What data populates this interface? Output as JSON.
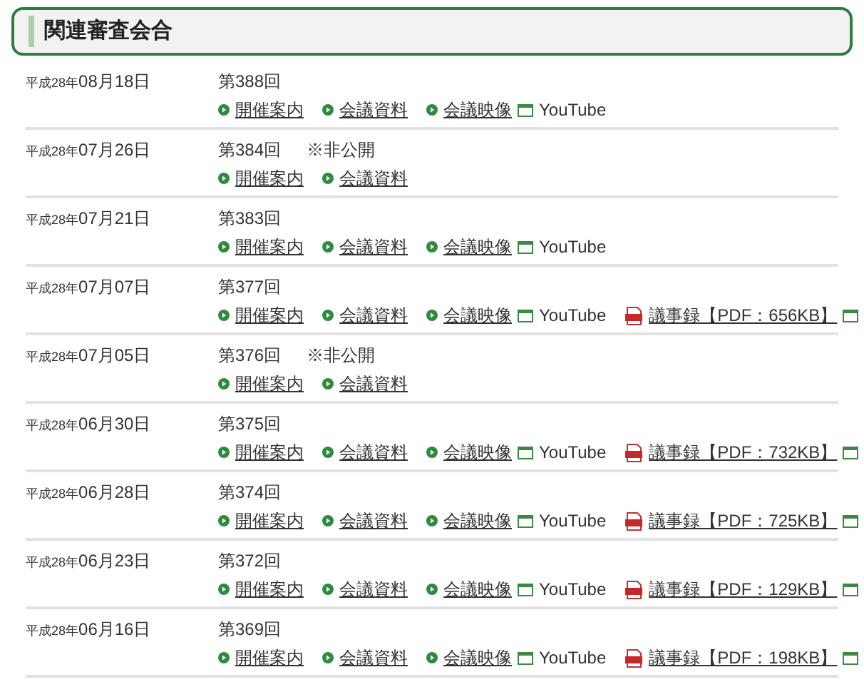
{
  "heading": "関連審査会合",
  "meetings": [
    {
      "era": "平成28年",
      "date": "08月18日",
      "session": "第388回",
      "links": [
        {
          "kind": "bullet",
          "label": "開催案内"
        },
        {
          "kind": "bullet",
          "label": "会議資料"
        },
        {
          "kind": "video",
          "label": "会議映像",
          "service": "YouTube"
        }
      ]
    },
    {
      "era": "平成28年",
      "date": "07月26日",
      "session": "第384回",
      "note": "※非公開",
      "links": [
        {
          "kind": "bullet",
          "label": "開催案内"
        },
        {
          "kind": "bullet",
          "label": "会議資料"
        }
      ]
    },
    {
      "era": "平成28年",
      "date": "07月21日",
      "session": "第383回",
      "links": [
        {
          "kind": "bullet",
          "label": "開催案内"
        },
        {
          "kind": "bullet",
          "label": "会議資料"
        },
        {
          "kind": "video",
          "label": "会議映像",
          "service": "YouTube"
        }
      ]
    },
    {
      "era": "平成28年",
      "date": "07月07日",
      "session": "第377回",
      "links": [
        {
          "kind": "bullet",
          "label": "開催案内"
        },
        {
          "kind": "bullet",
          "label": "会議資料"
        },
        {
          "kind": "video",
          "label": "会議映像",
          "service": "YouTube"
        },
        {
          "kind": "pdf",
          "label": "議事録【PDF：656KB】"
        }
      ]
    },
    {
      "era": "平成28年",
      "date": "07月05日",
      "session": "第376回",
      "note": "※非公開",
      "links": [
        {
          "kind": "bullet",
          "label": "開催案内"
        },
        {
          "kind": "bullet",
          "label": "会議資料"
        }
      ]
    },
    {
      "era": "平成28年",
      "date": "06月30日",
      "session": "第375回",
      "links": [
        {
          "kind": "bullet",
          "label": "開催案内"
        },
        {
          "kind": "bullet",
          "label": "会議資料"
        },
        {
          "kind": "video",
          "label": "会議映像",
          "service": "YouTube"
        },
        {
          "kind": "pdf",
          "label": "議事録【PDF：732KB】"
        }
      ]
    },
    {
      "era": "平成28年",
      "date": "06月28日",
      "session": "第374回",
      "links": [
        {
          "kind": "bullet",
          "label": "開催案内"
        },
        {
          "kind": "bullet",
          "label": "会議資料"
        },
        {
          "kind": "video",
          "label": "会議映像",
          "service": "YouTube"
        },
        {
          "kind": "pdf",
          "label": "議事録【PDF：725KB】"
        }
      ]
    },
    {
      "era": "平成28年",
      "date": "06月23日",
      "session": "第372回",
      "links": [
        {
          "kind": "bullet",
          "label": "開催案内"
        },
        {
          "kind": "bullet",
          "label": "会議資料"
        },
        {
          "kind": "video",
          "label": "会議映像",
          "service": "YouTube"
        },
        {
          "kind": "pdf",
          "label": "議事録【PDF：129KB】"
        }
      ]
    },
    {
      "era": "平成28年",
      "date": "06月16日",
      "session": "第369回",
      "links": [
        {
          "kind": "bullet",
          "label": "開催案内"
        },
        {
          "kind": "bullet",
          "label": "会議資料"
        },
        {
          "kind": "video",
          "label": "会議映像",
          "service": "YouTube"
        },
        {
          "kind": "pdf",
          "label": "議事録【PDF：198KB】"
        }
      ]
    }
  ]
}
